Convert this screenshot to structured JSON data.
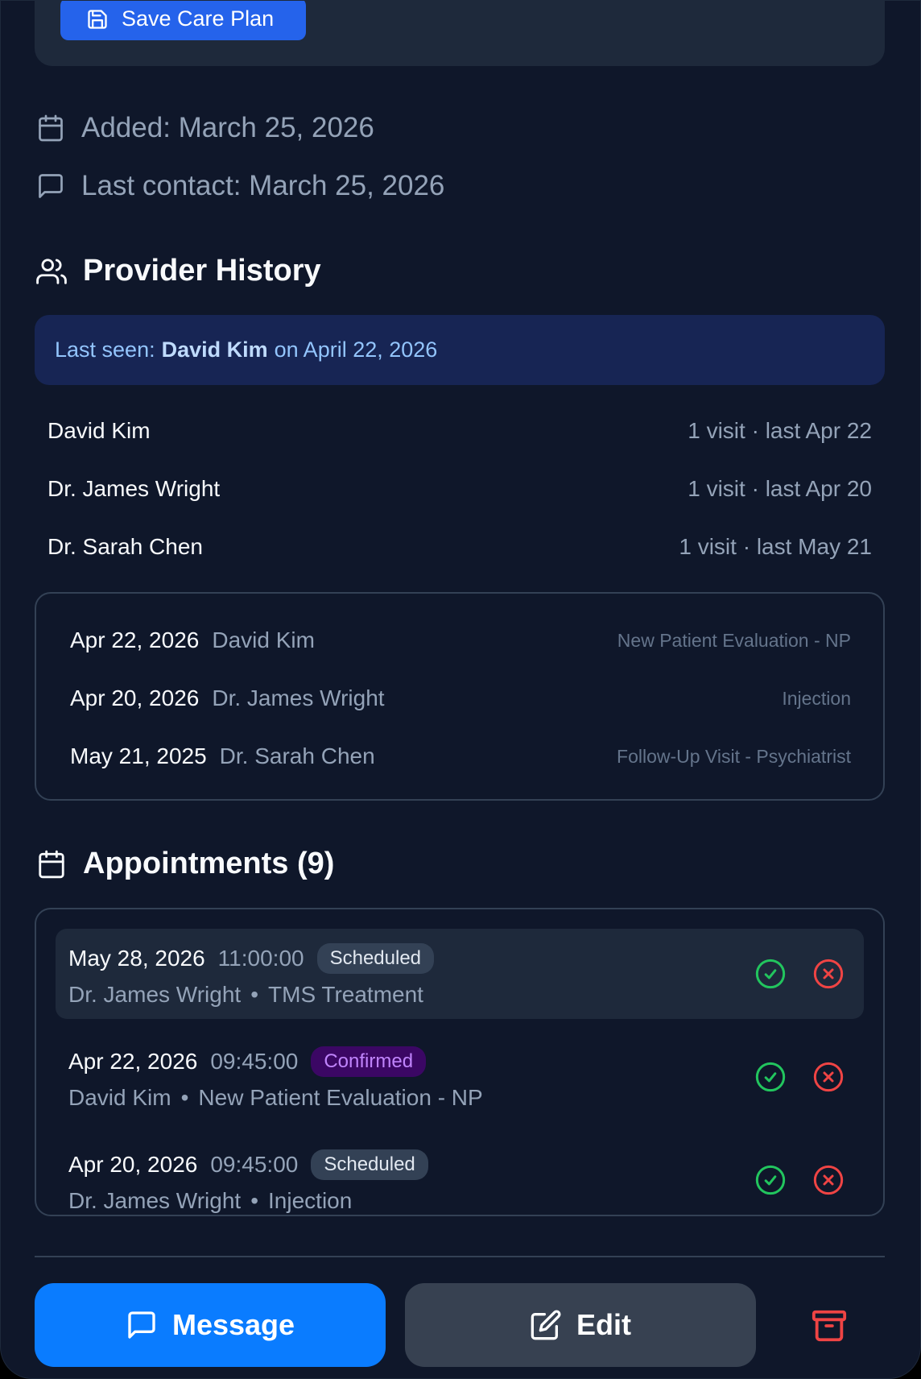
{
  "care_plan": {
    "save_label": "Save Care Plan"
  },
  "meta": {
    "added": "Added: March 25, 2026",
    "last_contact": "Last contact: March 25, 2026"
  },
  "provider_history": {
    "title": "Provider History",
    "last_seen_prefix": "Last seen:",
    "last_seen_name": "David Kim",
    "last_seen_suffix": "on April 22, 2026",
    "providers": [
      {
        "name": "David Kim",
        "info": "1 visit · last Apr 22"
      },
      {
        "name": "Dr. James Wright",
        "info": "1 visit · last Apr 20"
      },
      {
        "name": "Dr. Sarah Chen",
        "info": "1 visit · last May 21"
      }
    ],
    "visits": [
      {
        "date": "Apr 22, 2026",
        "provider": "David Kim",
        "type": "New Patient Evaluation - NP"
      },
      {
        "date": "Apr 20, 2026",
        "provider": "Dr. James Wright",
        "type": "Injection"
      },
      {
        "date": "May 21, 2025",
        "provider": "Dr. Sarah Chen",
        "type": "Follow-Up Visit - Psychiatrist"
      }
    ]
  },
  "appointments": {
    "title": "Appointments (9)",
    "items": [
      {
        "date": "May 28, 2026",
        "time": "11:00:00",
        "status": "Scheduled",
        "provider": "Dr. James Wright",
        "sep": "•",
        "type": "TMS Treatment"
      },
      {
        "date": "Apr 22, 2026",
        "time": "09:45:00",
        "status": "Confirmed",
        "provider": "David Kim",
        "sep": "•",
        "type": "New Patient Evaluation - NP"
      },
      {
        "date": "Apr 20, 2026",
        "time": "09:45:00",
        "status": "Scheduled",
        "provider": "Dr. James Wright",
        "sep": "•",
        "type": "Injection"
      }
    ]
  },
  "actions": {
    "message_label": "Message",
    "edit_label": "Edit"
  },
  "colors": {
    "accent": "#0a7cff",
    "confirm_green": "#22c55e",
    "cancel_red": "#ef4444",
    "confirmed_purple": "#c084fc"
  }
}
